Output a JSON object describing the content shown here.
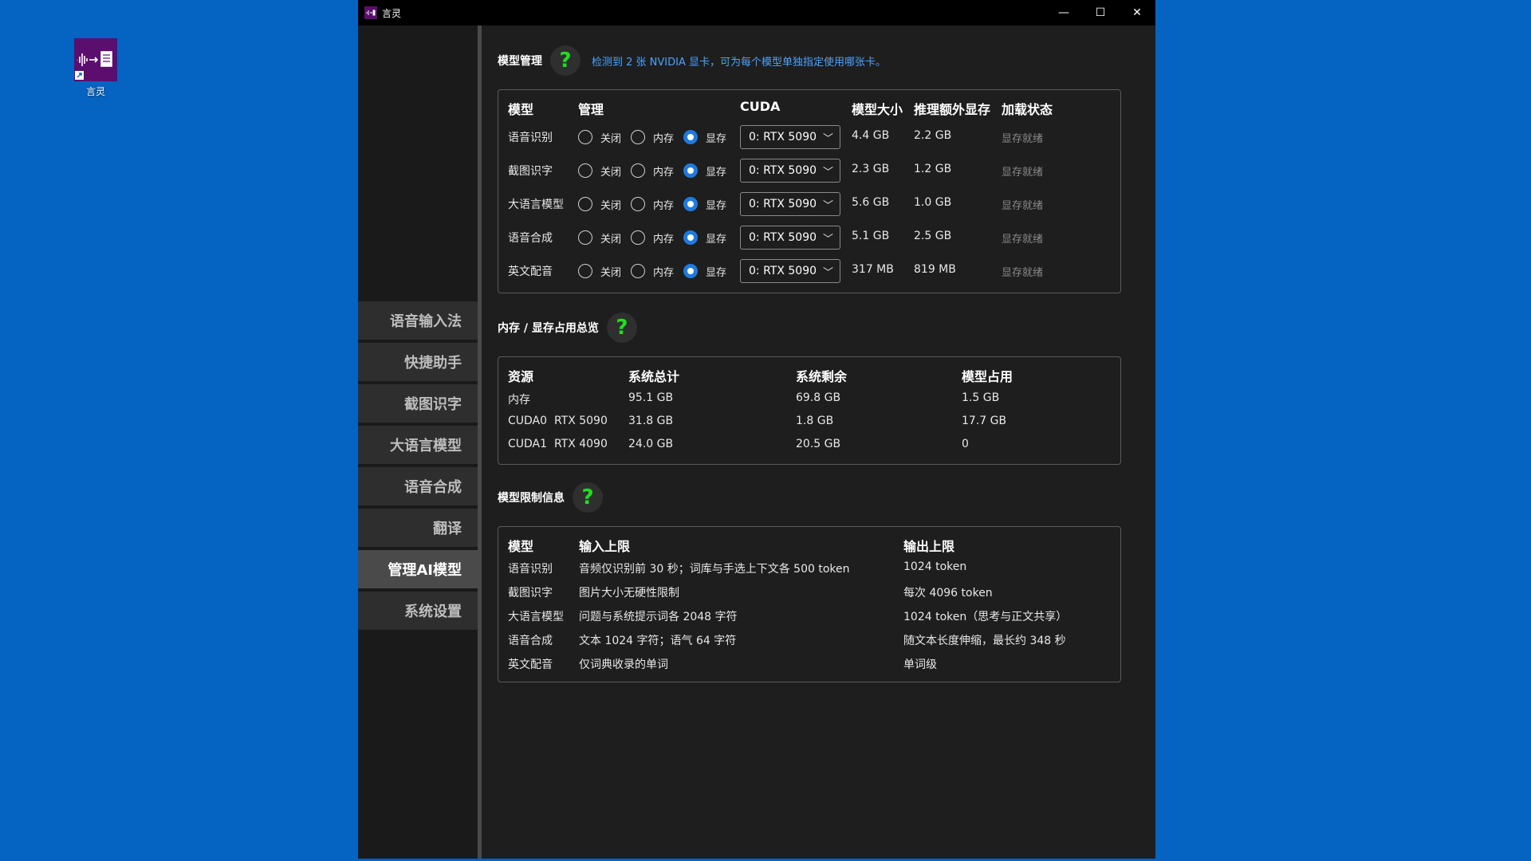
{
  "desktop": {
    "icon_label": "言灵"
  },
  "window": {
    "title": "言灵",
    "controls": {
      "minimize": "—",
      "maximize": "☐",
      "close": "✕"
    }
  },
  "sidebar": {
    "items": [
      {
        "label": "语音输入法",
        "active": false
      },
      {
        "label": "快捷助手",
        "active": false
      },
      {
        "label": "截图识字",
        "active": false
      },
      {
        "label": "大语言模型",
        "active": false
      },
      {
        "label": "语音合成",
        "active": false
      },
      {
        "label": "翻译",
        "active": false
      },
      {
        "label": "管理AI模型",
        "active": true
      },
      {
        "label": "系统设置",
        "active": false
      }
    ]
  },
  "models_section": {
    "title": "模型管理",
    "help": "?",
    "hint": "检测到 2 张 NVIDIA 显卡，可为每个模型单独指定使用哪张卡。",
    "headers": {
      "model": "模型",
      "manage": "管理",
      "cuda": "CUDA",
      "size": "模型大小",
      "extra": "推理额外显存",
      "status": "加载状态"
    },
    "options": {
      "off": "关闭",
      "mem": "内存",
      "vram": "显存"
    },
    "rows": [
      {
        "name": "语音识别",
        "selected": "vram",
        "device": "0: RTX 5090",
        "size": "4.4 GB",
        "extra": "2.2 GB",
        "status": "显存就绪"
      },
      {
        "name": "截图识字",
        "selected": "vram",
        "device": "0: RTX 5090",
        "size": "2.3 GB",
        "extra": "1.2 GB",
        "status": "显存就绪"
      },
      {
        "name": "大语言模型",
        "selected": "vram",
        "device": "0: RTX 5090",
        "size": "5.6 GB",
        "extra": "1.0 GB",
        "status": "显存就绪"
      },
      {
        "name": "语音合成",
        "selected": "vram",
        "device": "0: RTX 5090",
        "size": "5.1 GB",
        "extra": "2.5 GB",
        "status": "显存就绪"
      },
      {
        "name": "英文配音",
        "selected": "vram",
        "device": "0: RTX 5090",
        "size": "317 MB",
        "extra": "819 MB",
        "status": "显存就绪"
      }
    ]
  },
  "usage_section": {
    "title": "内存 / 显存占用总览",
    "help": "?",
    "headers": {
      "resource": "资源",
      "total": "系统总计",
      "free": "系统剩余",
      "used": "模型占用"
    },
    "rows": [
      {
        "resource": "内存",
        "total": "95.1 GB",
        "free": "69.8 GB",
        "used": "1.5 GB"
      },
      {
        "resource": "CUDA0  RTX 5090",
        "total": "31.8 GB",
        "free": "1.8 GB",
        "used": "17.7 GB"
      },
      {
        "resource": "CUDA1  RTX 4090",
        "total": "24.0 GB",
        "free": "20.5 GB",
        "used": "0"
      }
    ]
  },
  "limits_section": {
    "title": "模型限制信息",
    "help": "?",
    "headers": {
      "model": "模型",
      "input": "输入上限",
      "output": "输出上限"
    },
    "rows": [
      {
        "model": "语音识别",
        "input": "音频仅识别前 30 秒；词库与手选上下文各 500 token",
        "output": "1024 token"
      },
      {
        "model": "截图识字",
        "input": "图片大小无硬性限制",
        "output": "每次 4096 token"
      },
      {
        "model": "大语言模型",
        "input": "问题与系统提示词各 2048 字符",
        "output": "1024 token（思考与正文共享）"
      },
      {
        "model": "语音合成",
        "input": "文本 1024 字符；语气 64 字符",
        "output": "随文本长度伸缩，最长约 348 秒"
      },
      {
        "model": "英文配音",
        "input": "仅词典收录的单词",
        "output": "单词级"
      }
    ]
  }
}
